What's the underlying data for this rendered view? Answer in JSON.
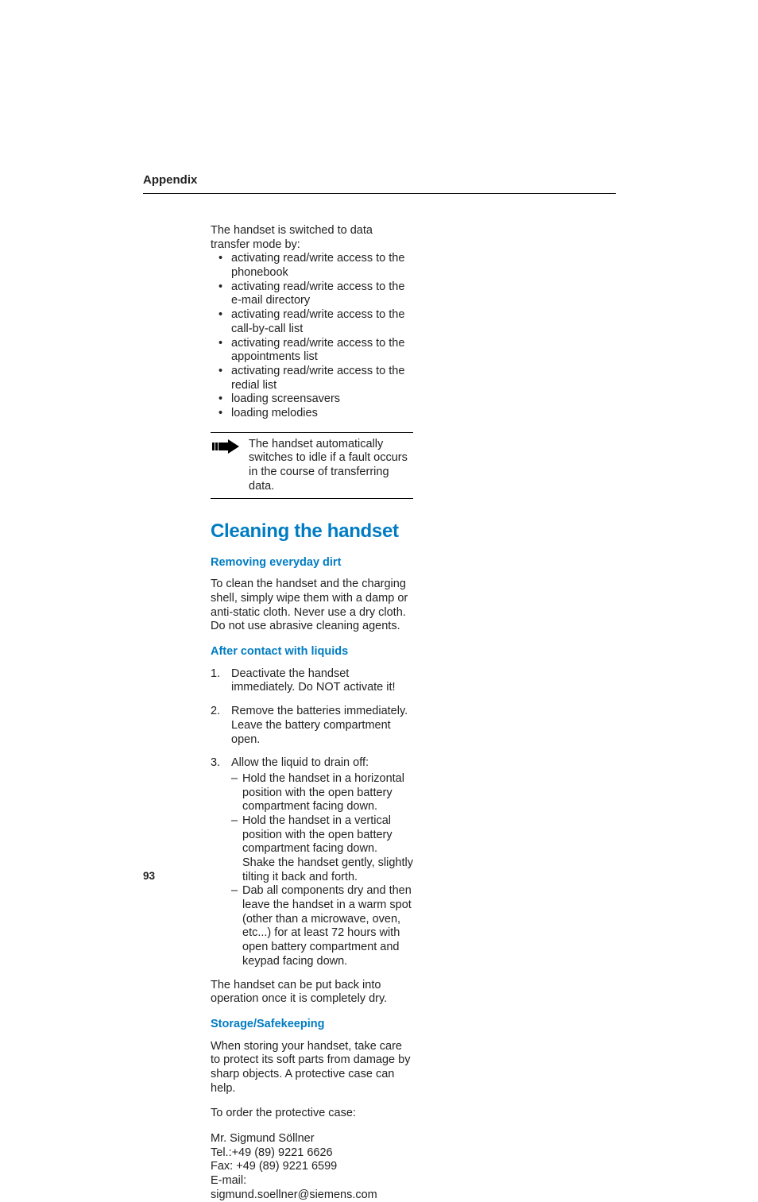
{
  "header": {
    "section": "Appendix"
  },
  "intro": {
    "lead": "The handset is switched to data transfer mode by:",
    "bullets": [
      "activating read/write access to the phonebook",
      "activating read/write access to the e-mail directory",
      "activating read/write access to the call-by-call list",
      "activating read/write access to the appointments list",
      "activating read/write access to the redial list",
      "loading screensavers",
      "loading melodies"
    ],
    "note": "The handset automatically switches to idle if a fault occurs in the course of transferring data."
  },
  "section": {
    "title": "Cleaning the handset",
    "s1": {
      "heading": "Removing everyday dirt",
      "p1": "To clean the handset and the charging shell, simply wipe them with a damp or anti-static cloth. Never use a dry cloth.",
      "p2": "Do not use abrasive cleaning agents."
    },
    "s2": {
      "heading": "After contact with liquids",
      "items": [
        {
          "num": "1.",
          "text": "Deactivate the handset immediately. Do NOT activate it!"
        },
        {
          "num": "2.",
          "text": "Remove the batteries immediately. Leave the battery compartment open."
        },
        {
          "num": "3.",
          "text": "Allow the liquid to drain off:",
          "sub": [
            "Hold the handset in a horizontal position with the open battery compartment facing down.",
            "Hold the handset in a vertical position with the open battery compartment facing down. Shake the handset gently, slightly tilting it back and forth.",
            "Dab all components dry and then leave the handset in a warm spot (other than a microwave, oven, etc...) for at least 72 hours with open battery compartment and keypad facing down."
          ]
        }
      ],
      "closing": "The handset can be put back into operation once it is completely dry."
    },
    "s3": {
      "heading": "Storage/Safekeeping",
      "p1": "When storing your handset, take care to protect its soft parts from damage by sharp objects. A protective case can help.",
      "p2": "To order the protective case:",
      "c1": "Mr. Sigmund Söllner",
      "c2": "Tel.:+49 (89) 9221 6626",
      "c3": "Fax: +49 (89) 9221 6599",
      "c4": "E-mail: sigmund.soellner@siemens.com"
    }
  },
  "pagenum": "93"
}
